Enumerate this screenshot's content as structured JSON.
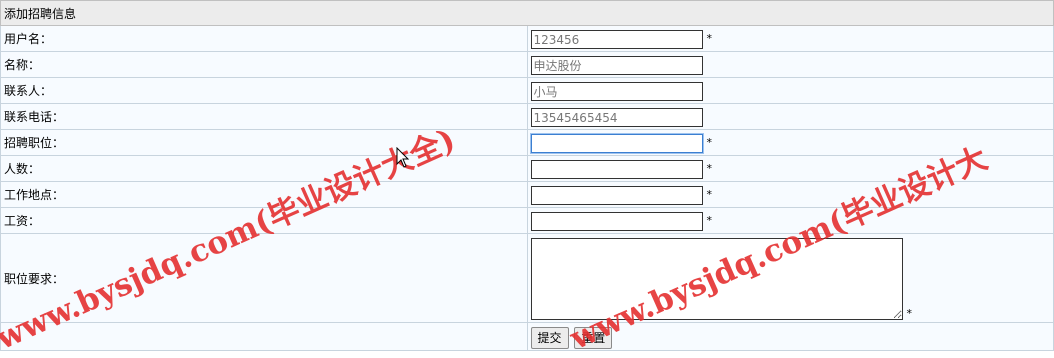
{
  "form": {
    "title": "添加招聘信息",
    "fields": [
      {
        "label": "用户名：",
        "value": "123456",
        "required": "*"
      },
      {
        "label": "名称：",
        "value": "申达股份",
        "required": ""
      },
      {
        "label": "联系人：",
        "value": "小马",
        "required": ""
      },
      {
        "label": "联系电话：",
        "value": "13545465454",
        "required": ""
      },
      {
        "label": "招聘职位：",
        "value": "",
        "required": "*"
      },
      {
        "label": "人数：",
        "value": "",
        "required": "*"
      },
      {
        "label": "工作地点：",
        "value": "",
        "required": "*"
      },
      {
        "label": "工资：",
        "value": "",
        "required": "*"
      }
    ],
    "requirements": {
      "label": "职位要求：",
      "value": "",
      "required": "*"
    },
    "submit_label": "提交",
    "reset_label": "重置"
  },
  "watermark": {
    "text_left": "www.bysjdq.com(毕业设计大全)",
    "text_right": "www.bysjdq.com(毕业设计大",
    "color": "#e53030"
  },
  "colors": {
    "header_bg": "#ececec",
    "row_bg": "#f7fbff",
    "border": "#c8d4de"
  }
}
